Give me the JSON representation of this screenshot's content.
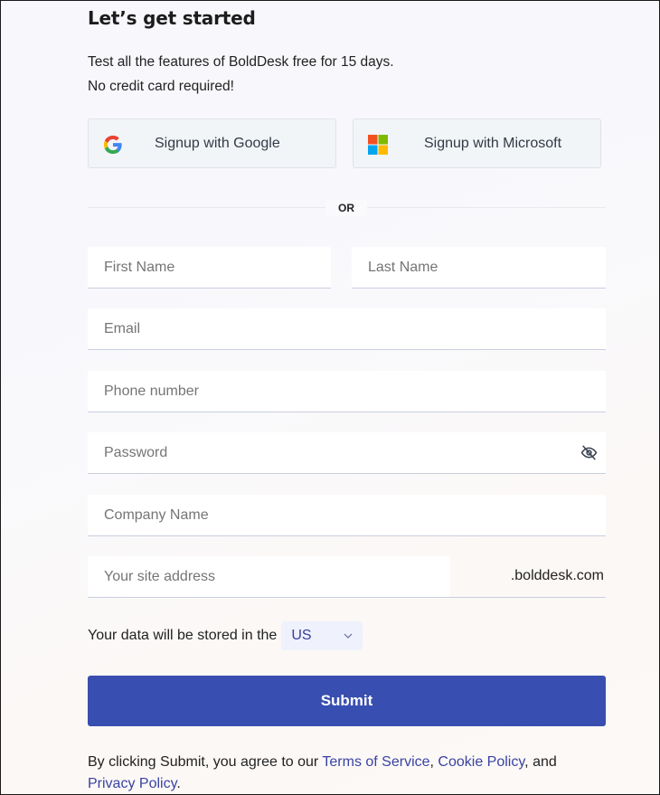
{
  "header": {
    "title": "Let’s get started",
    "subtitle_line1": "Test all the features of BoldDesk free for 15 days.",
    "subtitle_line2": "No credit card required!"
  },
  "sso": {
    "google_label": "Signup with Google",
    "microsoft_label": "Signup with Microsoft",
    "google_icon": "google-logo-icon",
    "microsoft_icon": "microsoft-logo-icon"
  },
  "divider": {
    "label": "OR"
  },
  "form": {
    "first_name": {
      "placeholder": "First Name",
      "value": ""
    },
    "last_name": {
      "placeholder": "Last Name",
      "value": ""
    },
    "email": {
      "placeholder": "Email",
      "value": ""
    },
    "phone": {
      "placeholder": "Phone number",
      "value": ""
    },
    "password": {
      "placeholder": "Password",
      "value": "",
      "toggle_icon": "eye-off-icon"
    },
    "company": {
      "placeholder": "Company Name",
      "value": ""
    },
    "site": {
      "placeholder": "Your site address",
      "value": "",
      "suffix": ".bolddesk.com"
    },
    "region": {
      "label": "Your data will be stored in the",
      "selected": "US"
    },
    "submit_label": "Submit"
  },
  "terms": {
    "prefix": "By clicking Submit, you agree to our ",
    "terms_link": "Terms of Service",
    "sep1": ", ",
    "cookie_link": "Cookie Policy",
    "sep2": ", and ",
    "privacy_link": "Privacy Policy",
    "suffix": "."
  },
  "colors": {
    "primary": "#384eb0",
    "link": "#3943a3",
    "select_bg": "#eff1fd"
  }
}
